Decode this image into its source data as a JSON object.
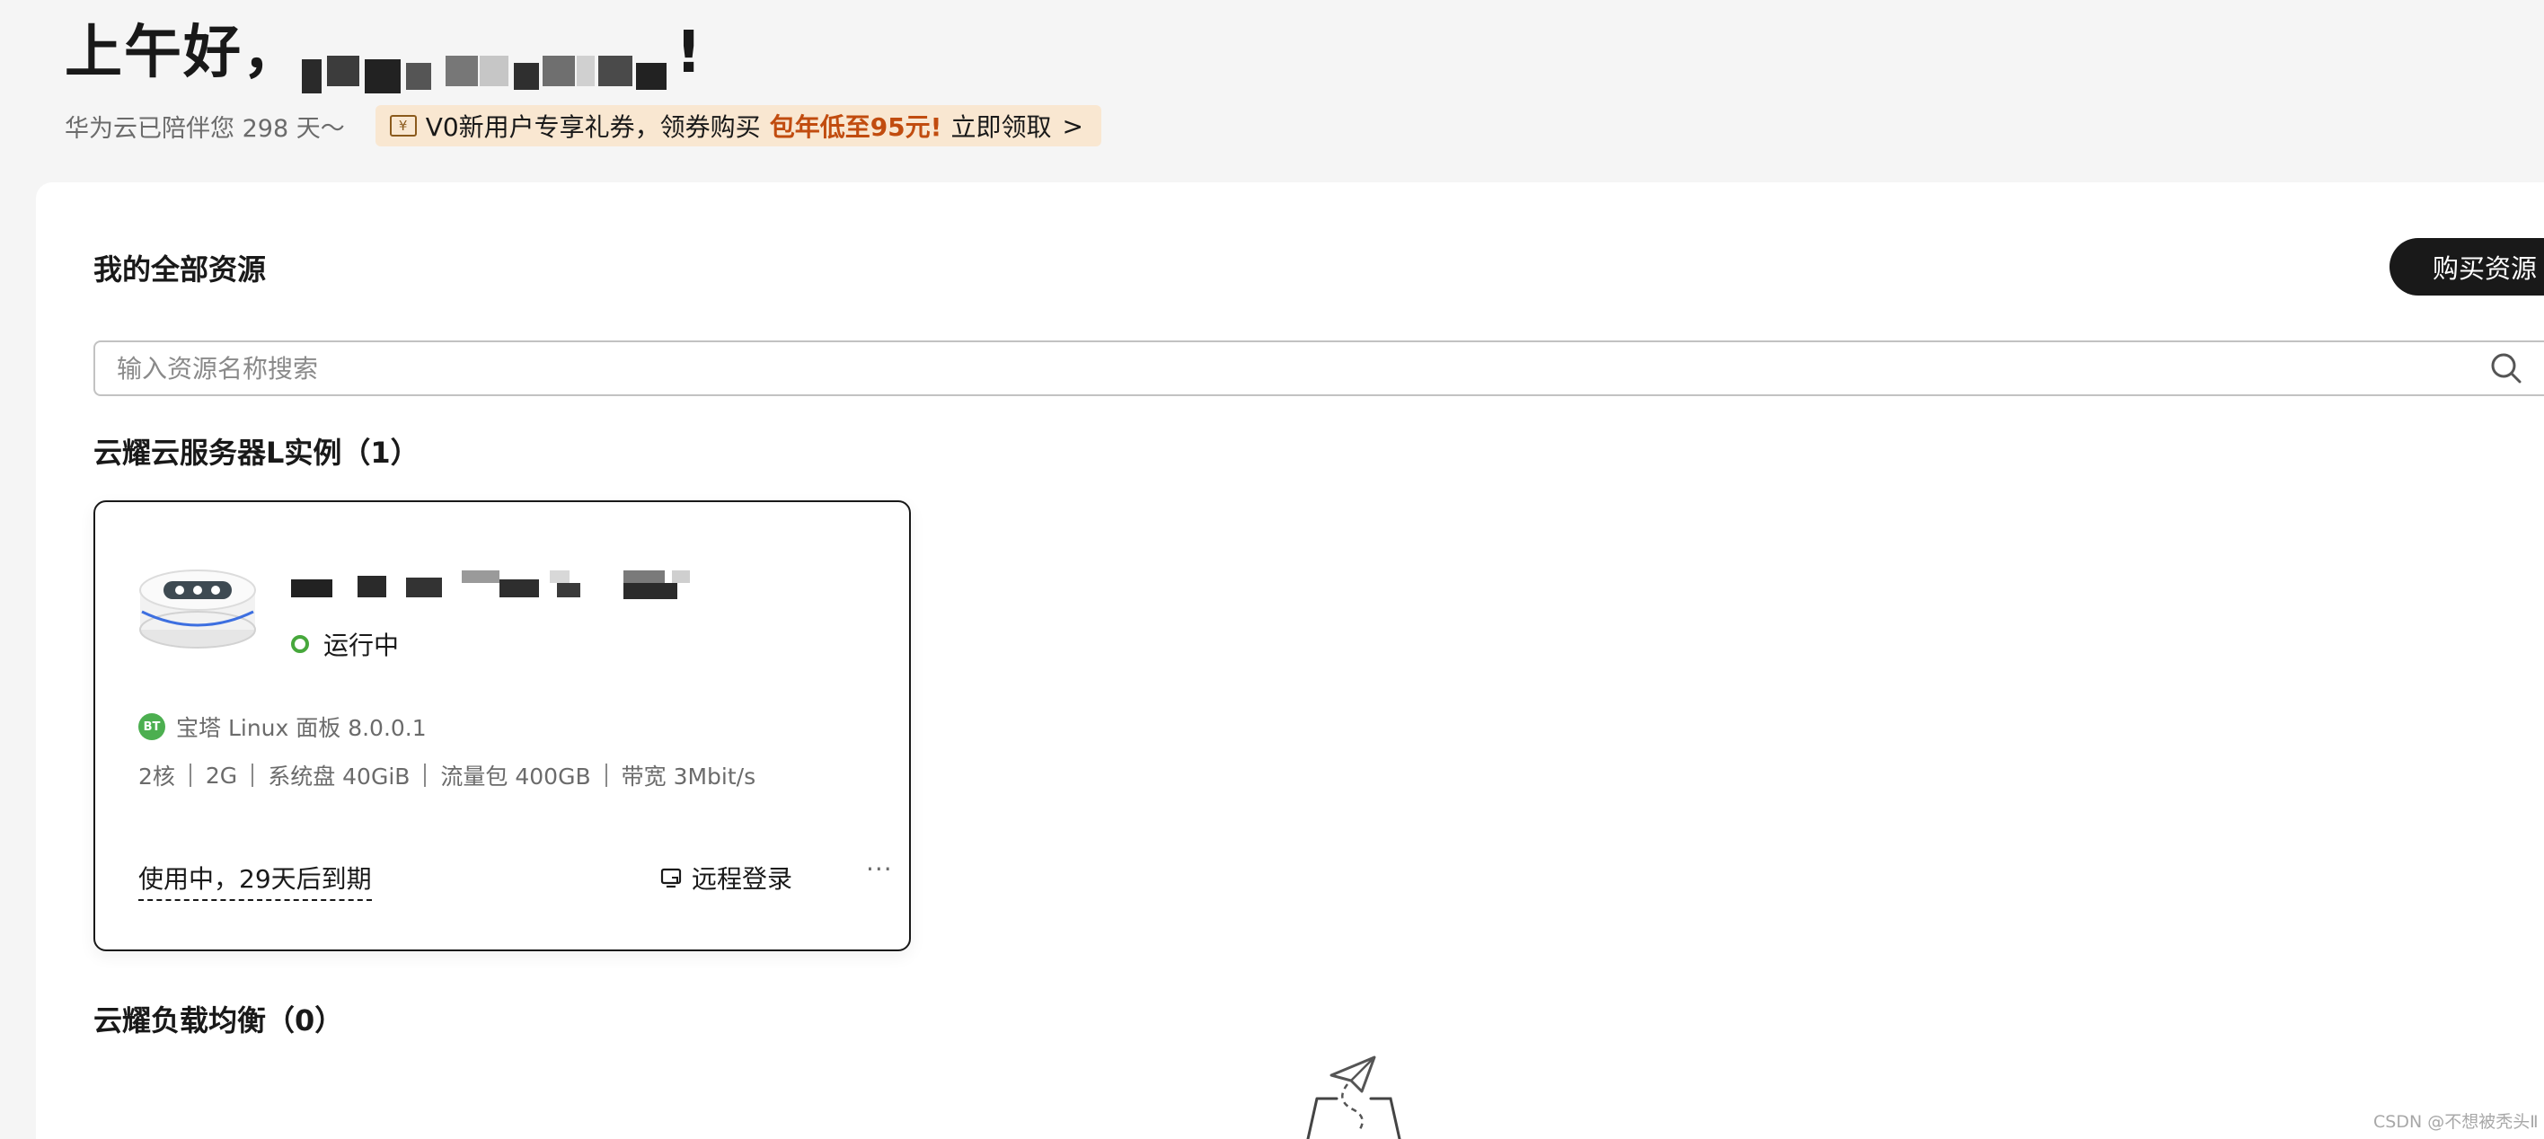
{
  "header": {
    "greeting": "上午好，",
    "greeting_suffix": "!",
    "days_text": "华为云已陪伴您 298 天～",
    "promo": {
      "icon": "coupon-icon",
      "text": "V0新用户专享礼券，领券购买",
      "highlight": "包年低至95元!",
      "action": "立即领取",
      "chevron": ">"
    },
    "colors": {
      "promo_bg": "#f9e7d1",
      "promo_highlight": "#c14c0f"
    }
  },
  "main": {
    "title": "我的全部资源",
    "buy_button": "购买资源",
    "search": {
      "placeholder": "输入资源名称搜索",
      "value": "",
      "icon": "search-icon"
    },
    "sections": [
      {
        "title": "云耀云服务器L实例（1）",
        "cards": [
          {
            "status": "运行中",
            "status_color": "#47a83c",
            "image_label": "宝塔 Linux 面板 8.0.0.1",
            "badge": "BT",
            "specs": [
              "2核",
              "2G",
              "系统盘 40GiB",
              "流量包 400GB",
              "带宽 3Mbit/s"
            ],
            "expiry": "使用中，29天后到期",
            "remote_login": "远程登录",
            "more": "···"
          }
        ]
      },
      {
        "title": "云耀负载均衡（0）",
        "cards": []
      }
    ]
  },
  "watermark": "CSDN @不想被秃头Ⅱ"
}
